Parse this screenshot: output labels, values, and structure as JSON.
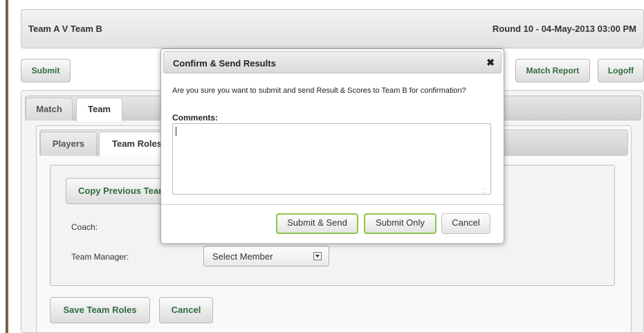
{
  "header": {
    "match_title": "Team A V Team B",
    "round_info": "Round 10 - 04-May-2013 03:00 PM"
  },
  "toolbar": {
    "submit_label": "Submit",
    "match_report_label": "Match Report",
    "logoff_label": "Logoff"
  },
  "outer_tabs": [
    {
      "label": "Match",
      "active": false
    },
    {
      "label": "Team",
      "active": true
    }
  ],
  "inner_tabs": [
    {
      "label": "Players",
      "active": false
    },
    {
      "label": "Team Roles",
      "active": true
    }
  ],
  "team_roles": {
    "copy_previous_label": "Copy Previous Team Roles",
    "coach_label": "Coach:",
    "team_manager_label": "Team Manager:",
    "team_manager_select": "Select Member",
    "save_label": "Save Team Roles",
    "cancel_label": "Cancel"
  },
  "modal": {
    "title": "Confirm & Send Results",
    "close_glyph": "✖",
    "message": "Are you sure you want to submit and send Result & Scores to Team B for confirmation?",
    "comments_label": "Comments:",
    "comments_value": "",
    "buttons": {
      "submit_send": "Submit & Send",
      "submit_only": "Submit Only",
      "cancel": "Cancel"
    }
  },
  "colors": {
    "accent_green": "#2e7d4f",
    "accent_red": "#b5493a",
    "button_text_green": "#2f6b3f",
    "highlight_green": "#8ac64a"
  }
}
